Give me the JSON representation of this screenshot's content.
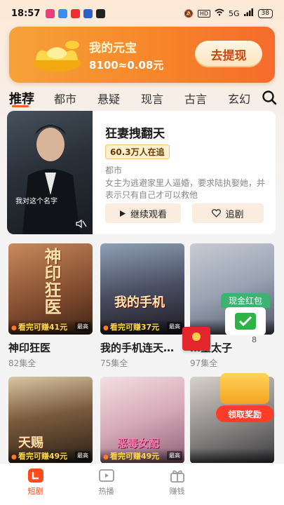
{
  "status_bar": {
    "time": "18:57",
    "network": "HD",
    "signal": "5G",
    "battery": "38"
  },
  "banner": {
    "title": "我的元宝",
    "amount": "8100≈0.08元",
    "button": "去提现"
  },
  "tabs": [
    {
      "label": "推荐",
      "active": true
    },
    {
      "label": "都市"
    },
    {
      "label": "悬疑"
    },
    {
      "label": "现言"
    },
    {
      "label": "古言"
    },
    {
      "label": "玄幻"
    }
  ],
  "featured": {
    "title": "狂妻拽翻天",
    "badge": "60.3万人在追",
    "genre": "都市",
    "description": "女主为逃避家里人逼婚，要求陆执娶她，并表示只有自己才可以救他",
    "poster_subtitle": "我对这个名字",
    "continue_label": "继续观看",
    "follow_label": "追剧"
  },
  "grid": [
    {
      "title": "神印狂医",
      "episodes": "82集全",
      "earn": "看完可赚41元",
      "tag": "最高",
      "art": "神印狂医"
    },
    {
      "title": "我的手机连天…",
      "episodes": "75集全",
      "earn": "看完可赚37元",
      "tag": "最高",
      "art": "我的手机"
    },
    {
      "title": "…皇太子",
      "episodes": "97集全",
      "earn": "",
      "tag": "",
      "art": ""
    },
    {
      "title": "",
      "episodes": "",
      "earn": "看完可赚49元",
      "tag": "最高",
      "art": "天赐"
    },
    {
      "title": "",
      "episodes": "",
      "earn": "看完可赚49元",
      "tag": "最高",
      "art": "恶毒女配"
    },
    {
      "title": "",
      "episodes": "",
      "earn": "",
      "tag": "",
      "art": ""
    }
  ],
  "widgets": {
    "cash_title": "现金红包",
    "cash_counter": "8",
    "claim_label": "领取奖励"
  },
  "bottom_nav": [
    {
      "label": "短剧",
      "icon": "play-square-icon",
      "active": true
    },
    {
      "label": "热播",
      "icon": "video-icon"
    },
    {
      "label": "赚钱",
      "icon": "gift-icon"
    },
    {
      "label": "",
      "icon": "profile-icon"
    }
  ],
  "colors": {
    "accent": "#ff5a1f",
    "banner": "#f7862a",
    "nav_active": "#ff4a1c"
  }
}
